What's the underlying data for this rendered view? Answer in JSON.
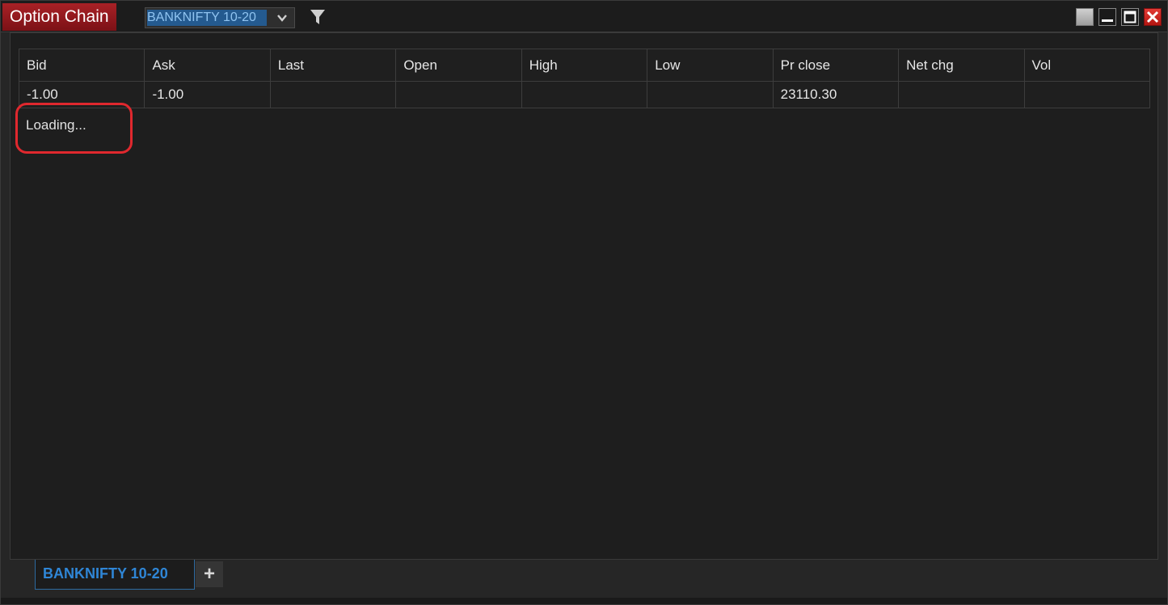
{
  "window": {
    "title": "Option Chain",
    "symbol_value": "BANKNIFTY 10-20"
  },
  "icons": {
    "dropdown": "chevron-down-icon",
    "filter": "filter-icon",
    "restore": "restore-icon",
    "minimize": "minimize-icon",
    "maximize": "maximize-icon",
    "close": "close-icon"
  },
  "table": {
    "columns": [
      "Bid",
      "Ask",
      "Last",
      "Open",
      "High",
      "Low",
      "Pr close",
      "Net chg",
      "Vol"
    ],
    "rows": [
      [
        "-1.00",
        "-1.00",
        "",
        "",
        "",
        "",
        "23110.30",
        "",
        ""
      ]
    ]
  },
  "status": {
    "loading_text": "Loading..."
  },
  "tabs": {
    "active_label": "BANKNIFTY 10-20",
    "add_label": "+"
  },
  "colors": {
    "title_bg": "#9a1b20",
    "tab_active_text": "#2f86d6",
    "highlight_ring": "#e0282e",
    "close_button": "#d02a25"
  }
}
